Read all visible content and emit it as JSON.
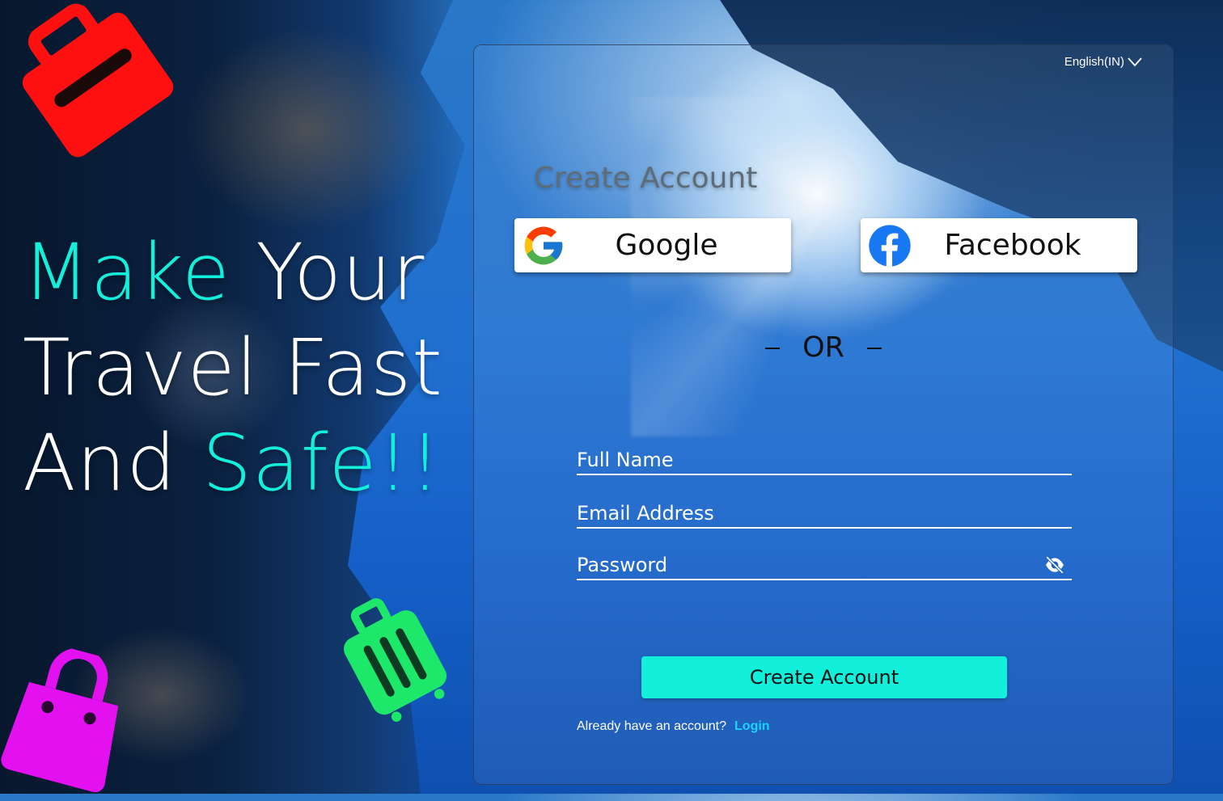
{
  "hero": {
    "line1_accent": "Make",
    "line1_rest": " Your",
    "line2": "Travel Fast",
    "line3_start": "And ",
    "line3_accent": "Safe!!"
  },
  "card": {
    "language": "English(IN)",
    "title": "Create Account",
    "google_label": "Google",
    "facebook_label": "Facebook",
    "or_text": "OR",
    "full_name_placeholder": "Full Name",
    "email_placeholder": "Email Address",
    "password_placeholder": "Password",
    "submit_label": "Create Account",
    "already_text": "Already have an account?",
    "login_link": "Login"
  },
  "colors": {
    "accent": "#12f0dc",
    "login_link": "#1ad4ff",
    "deco_red": "#ff1010",
    "deco_pink": "#e310f0",
    "deco_green": "#1ee86a"
  },
  "icons": [
    "chevron-down-icon",
    "google-icon",
    "facebook-icon",
    "eye-off-icon",
    "briefcase-icon",
    "shopping-bag-icon",
    "suitcase-icon"
  ]
}
